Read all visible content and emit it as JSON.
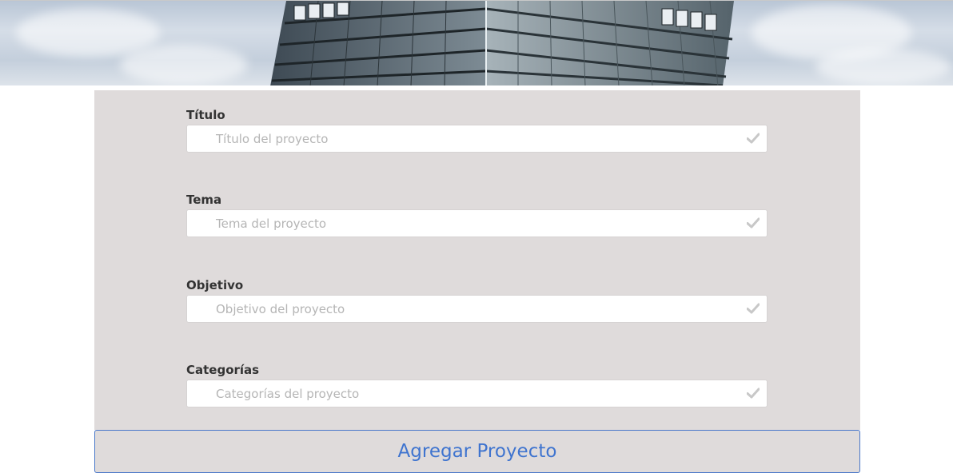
{
  "banner": {
    "icon": "building-photo"
  },
  "form": {
    "fields": [
      {
        "label": "Título",
        "placeholder": "Título del proyecto",
        "value": "",
        "icon": "check-icon"
      },
      {
        "label": "Tema",
        "placeholder": "Tema del proyecto",
        "value": "",
        "icon": "check-icon"
      },
      {
        "label": "Objetivo",
        "placeholder": "Objetivo del proyecto",
        "value": "",
        "icon": "check-icon"
      },
      {
        "label": "Categorías",
        "placeholder": "Categorías del proyecto",
        "value": "",
        "icon": "check-icon"
      }
    ],
    "submit_label": "Agregar Proyecto"
  },
  "colors": {
    "panel_background": "#dfdbdb",
    "accent": "#3f74cf",
    "label_text": "#333333",
    "placeholder_text": "#b5b5b5",
    "check_icon": "#c8c8c8"
  }
}
